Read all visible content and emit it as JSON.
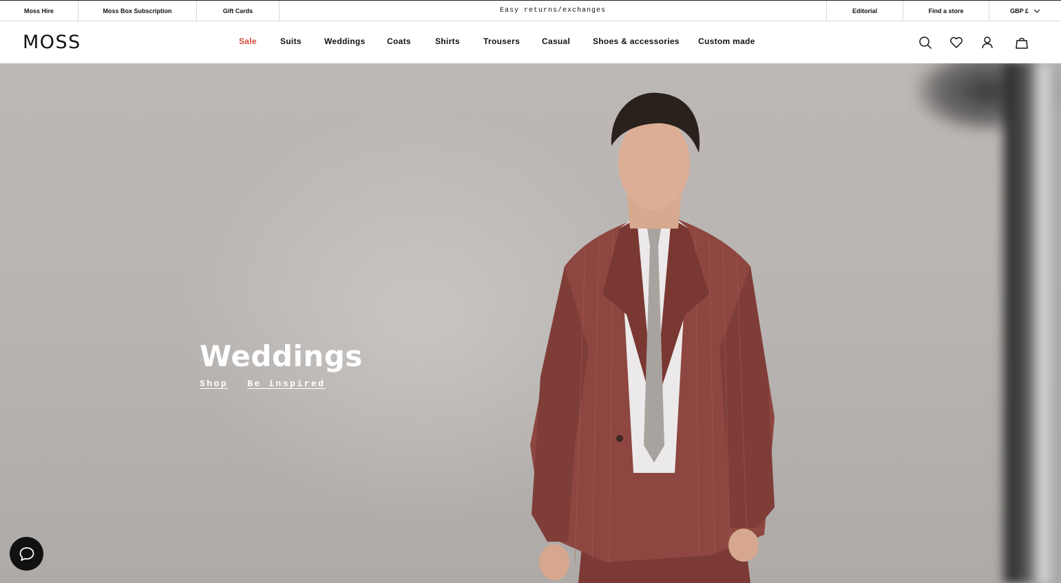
{
  "topbar": {
    "left_links": [
      "Moss Hire",
      "Moss Box Subscription",
      "Gift Cards"
    ],
    "promo": "Easy returns/exchanges",
    "right_links": [
      "Editorial",
      "Find a store"
    ],
    "currency": "GBP £",
    "currency_icon": "chevron-down-icon"
  },
  "header": {
    "logo": "MOSS",
    "nav": [
      "Sale",
      "Suits",
      "Weddings",
      "Coats",
      "Shirts",
      "Trousers",
      "Casual",
      "Shoes & accessories",
      "Custom made"
    ],
    "sale_color": "#d64a3b",
    "icons": [
      "search-icon",
      "heart-icon",
      "account-icon",
      "bag-icon"
    ]
  },
  "hero": {
    "title": "Weddings",
    "links": [
      "Shop",
      "Be inspired"
    ]
  },
  "chat": {
    "icon": "chat-bubble-icon"
  }
}
